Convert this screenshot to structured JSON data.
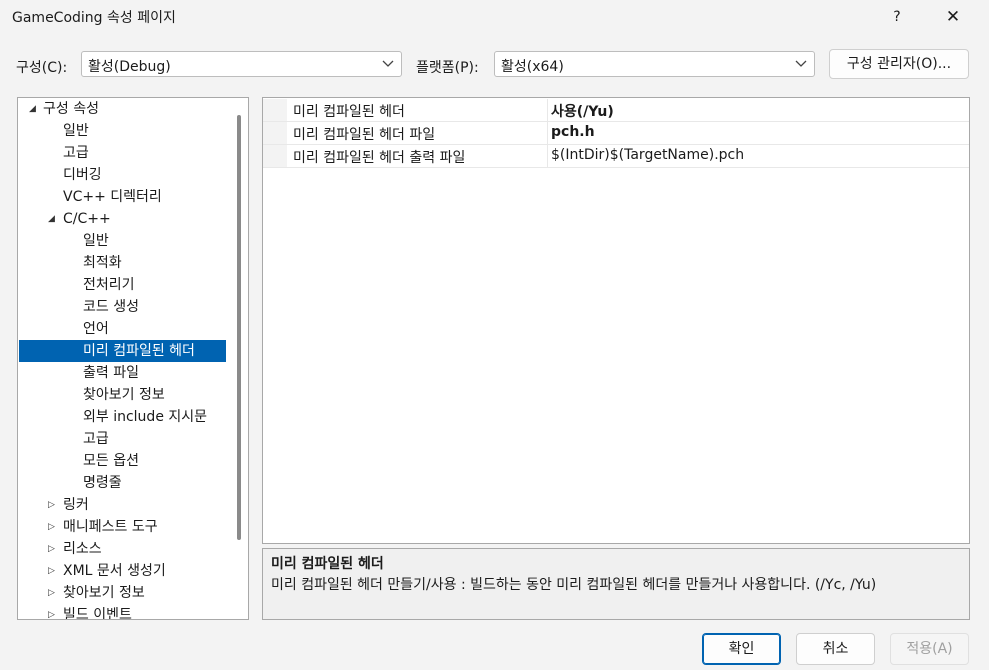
{
  "window": {
    "title": "GameCoding 속성 페이지",
    "help": "?",
    "close": "✕"
  },
  "config": {
    "config_label": "구성(C):",
    "config_value": "활성(Debug)",
    "platform_label": "플랫폼(P):",
    "platform_value": "활성(x64)",
    "manager_button": "구성 관리자(O)..."
  },
  "tree": {
    "items": [
      {
        "label": "구성 속성",
        "level": 0,
        "expander": "expanded"
      },
      {
        "label": "일반",
        "level": 1
      },
      {
        "label": "고급",
        "level": 1
      },
      {
        "label": "디버깅",
        "level": 1
      },
      {
        "label": "VC++ 디렉터리",
        "level": 1
      },
      {
        "label": "C/C++",
        "level": 1,
        "expander": "expanded"
      },
      {
        "label": "일반",
        "level": 2
      },
      {
        "label": "최적화",
        "level": 2
      },
      {
        "label": "전처리기",
        "level": 2
      },
      {
        "label": "코드 생성",
        "level": 2
      },
      {
        "label": "언어",
        "level": 2
      },
      {
        "label": "미리 컴파일된 헤더",
        "level": 2,
        "selected": true
      },
      {
        "label": "출력 파일",
        "level": 2
      },
      {
        "label": "찾아보기 정보",
        "level": 2
      },
      {
        "label": "외부 include 지시문",
        "level": 2
      },
      {
        "label": "고급",
        "level": 2
      },
      {
        "label": "모든 옵션",
        "level": 2
      },
      {
        "label": "명령줄",
        "level": 2
      },
      {
        "label": "링커",
        "level": 1,
        "expander": "collapsed"
      },
      {
        "label": "매니페스트 도구",
        "level": 1,
        "expander": "collapsed"
      },
      {
        "label": "리소스",
        "level": 1,
        "expander": "collapsed"
      },
      {
        "label": "XML 문서 생성기",
        "level": 1,
        "expander": "collapsed"
      },
      {
        "label": "찾아보기 정보",
        "level": 1,
        "expander": "collapsed"
      },
      {
        "label": "빌드 이벤트",
        "level": 1,
        "expander": "collapsed"
      }
    ]
  },
  "properties": [
    {
      "name": "미리 컴파일된 헤더",
      "value": "사용(/Yu)",
      "bold": true
    },
    {
      "name": "미리 컴파일된 헤더 파일",
      "value": "pch.h",
      "bold": true
    },
    {
      "name": "미리 컴파일된 헤더 출력 파일",
      "value": "$(IntDir)$(TargetName).pch",
      "bold": false
    }
  ],
  "description": {
    "title": "미리 컴파일된 헤더",
    "text": "미리 컴파일된 헤더 만들기/사용 : 빌드하는 동안 미리 컴파일된 헤더를 만들거나 사용합니다.     (/Yc, /Yu)"
  },
  "buttons": {
    "ok": "확인",
    "cancel": "취소",
    "apply": "적용(A)"
  },
  "colors": {
    "selection": "#0063b1",
    "background": "#f3f3f3"
  }
}
